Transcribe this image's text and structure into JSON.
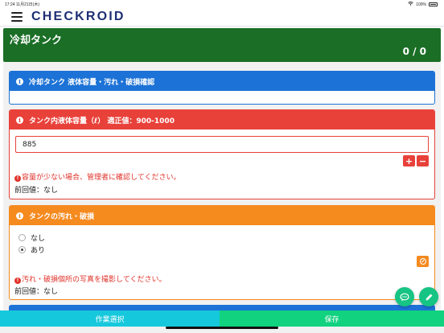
{
  "status_bar": {
    "time": "17:24  11月21日(木)",
    "battery": "100%"
  },
  "header": {
    "logo": "CHECKROID"
  },
  "section": {
    "title": "冷却タンク",
    "count": "0 / 0"
  },
  "cards": {
    "overview": {
      "title": "冷却タンク 液体容量・汚れ・破損確認"
    },
    "volume": {
      "title": "タンク内液体容量（ℓ） 適正値：900-1000",
      "value": "885",
      "plus_label": "+",
      "minus_label": "−",
      "warning": "容量が少ない場合、管理者に確認してください。",
      "previous": "前回値：なし"
    },
    "dirt": {
      "title": "タンクの汚れ・破損",
      "options": [
        "なし",
        "あり"
      ],
      "selected": "あり",
      "warning": "汚れ・破損個所の写真を撮影してください。",
      "previous": "前回値：なし"
    }
  },
  "bottom_bar": {
    "left_label": "作業選択",
    "right_label": "保存"
  },
  "colors": {
    "section_green": "#1b6e26",
    "blue": "#1c72d6",
    "red": "#e8413a",
    "orange": "#f58a1f",
    "teal": "#16c8dc",
    "green": "#10d27f"
  },
  "icons": [
    "menu-icon",
    "info-icon",
    "plus-icon",
    "minus-icon",
    "ban-icon",
    "chat-icon",
    "pencil-icon",
    "battery-icon"
  ]
}
